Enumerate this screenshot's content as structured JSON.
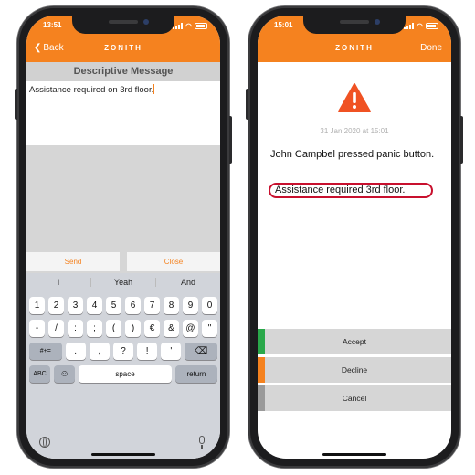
{
  "left_phone": {
    "status_time": "13:51",
    "brand": "ZONITH",
    "nav_back_label": "Back",
    "title": "Descriptive Message",
    "message_text": "Assistance required on 3rd floor.",
    "send_label": "Send",
    "close_label": "Close",
    "keyboard": {
      "suggestions": [
        "I",
        "Yeah",
        "And"
      ],
      "row1": [
        "1",
        "2",
        "3",
        "4",
        "5",
        "6",
        "7",
        "8",
        "9",
        "0"
      ],
      "row2": [
        "-",
        "/",
        ":",
        ";",
        "(",
        ")",
        "€",
        "&",
        "@",
        "\""
      ],
      "row3_left": "#+=",
      "row3": [
        ".",
        ",",
        "?",
        "!",
        "'"
      ],
      "row3_right_icon": "backspace-icon",
      "abc_label": "ABC",
      "emoji_icon": "emoji-icon",
      "space_label": "space",
      "return_label": "return",
      "globe_icon": "globe-icon",
      "mic_icon": "microphone-icon"
    }
  },
  "right_phone": {
    "status_time": "15:01",
    "brand": "ZONITH",
    "nav_done_label": "Done",
    "warning_icon": "warning-triangle-icon",
    "date_text": "31 Jan 2020 at 15:01",
    "message_line": "John Campbel pressed panic button.",
    "highlight_text": "Assistance required 3rd floor.",
    "buttons": [
      {
        "label": "Accept",
        "color": "#2aa84a"
      },
      {
        "label": "Decline",
        "color": "#f5821f"
      },
      {
        "label": "Cancel",
        "color": "#9a9a9a"
      }
    ]
  },
  "colors": {
    "accent": "#f5821f",
    "highlight_ring": "#c8102e"
  }
}
